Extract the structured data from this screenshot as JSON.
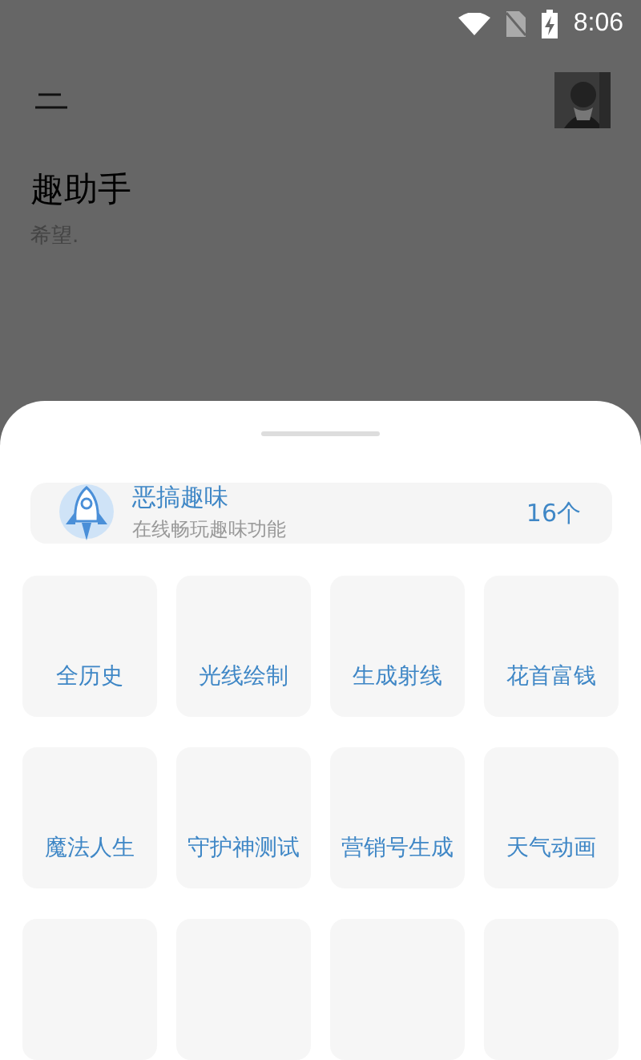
{
  "status_bar": {
    "time": "8:06"
  },
  "header": {
    "title": "趣助手",
    "subtitle": "希望."
  },
  "category": {
    "title": "恶搞趣味",
    "subtitle": "在线畅玩趣味功能",
    "count": "16个"
  },
  "tools": [
    {
      "label": "全历史"
    },
    {
      "label": "光线绘制"
    },
    {
      "label": "生成射线"
    },
    {
      "label": "花首富钱"
    },
    {
      "label": "魔法人生"
    },
    {
      "label": "守护神测试"
    },
    {
      "label": "营销号生成"
    },
    {
      "label": "天气动画"
    }
  ]
}
